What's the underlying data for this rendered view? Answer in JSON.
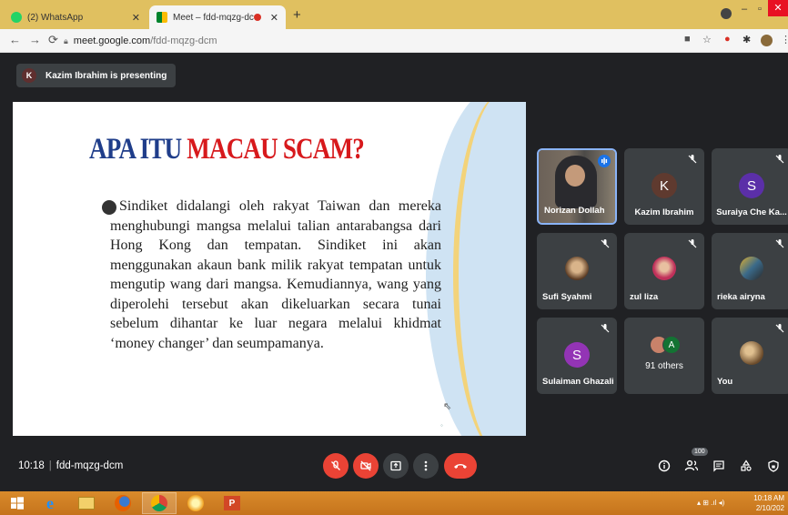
{
  "browser": {
    "tabs": [
      {
        "title": "(2) WhatsApp",
        "active": false,
        "icon": "whatsapp-icon"
      },
      {
        "title": "Meet – fdd-mqzg-dcm",
        "active": true,
        "icon": "meet-icon"
      }
    ],
    "url_host": "meet.google.com",
    "url_path": "/fdd-mqzg-dcm"
  },
  "meet": {
    "presenter_initial": "K",
    "presenter_text": "Kazim Ibrahim is presenting",
    "slide": {
      "title_part1": "APA ITU ",
      "title_part2": "MACAU SCAM?",
      "body": "Sindiket didalangi oleh rakyat Taiwan dan mereka menghubungi mangsa melalui talian antarabangsa dari Hong Kong dan tempatan. Sindiket ini akan menggunakan akaun bank milik rakyat tempatan untuk mengutip wang dari mangsa. Kemudiannya, wang yang diperolehi tersebut akan dikeluarkan secara tunai sebelum dihantar ke luar negara melalui khidmat ‘money changer’ dan seumpamanya."
    },
    "participants": [
      {
        "name": "Norizan Dollah",
        "type": "video",
        "speaking": true
      },
      {
        "name": "Kazim Ibrahim",
        "type": "letter",
        "letter": "K",
        "color": "#5f3a2f",
        "muted": true
      },
      {
        "name": "Suraiya Che Ka...",
        "type": "letter",
        "letter": "S",
        "color": "#5b2fa8",
        "muted": true
      },
      {
        "name": "Sufi Syahmi",
        "type": "photo",
        "color": "#8a5a3a",
        "muted": true
      },
      {
        "name": "zul liza",
        "type": "photo",
        "color": "#b8446a",
        "muted": true
      },
      {
        "name": "rieka airyna",
        "type": "photo",
        "color": "#3a6a8a",
        "muted": true
      },
      {
        "name": "Sulaiman Ghazali",
        "type": "letter",
        "letter": "S",
        "color": "#9334b5",
        "muted": true
      },
      {
        "name": "91 others",
        "type": "others",
        "letter": "A"
      },
      {
        "name": "You",
        "type": "photo",
        "color": "#8a6a3a",
        "muted": true
      }
    ],
    "time": "10:18",
    "meeting_code": "fdd-mqzg-dcm",
    "participant_count": "100"
  },
  "taskbar": {
    "clock_time": "10:18 AM",
    "clock_date": "2/10/202"
  },
  "colors": {
    "meet_bg": "#202124",
    "tile_bg": "#3c4043",
    "red": "#ea4335",
    "taskbar": "#d98b2b"
  }
}
